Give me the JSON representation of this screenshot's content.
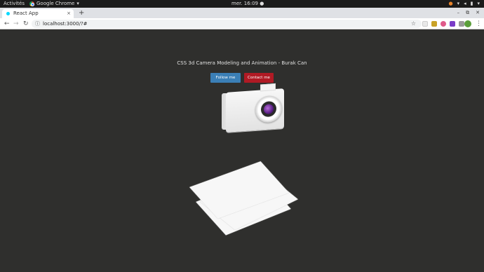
{
  "system": {
    "activities": "Activités",
    "app_name": "Google Chrome",
    "clock": "mer. 16:09"
  },
  "browser": {
    "tab_title": "React App",
    "url": "localhost:3000/?#",
    "new_tab_symbol": "+",
    "close_tab_symbol": "×"
  },
  "page": {
    "title": "CSS 3d Camera Modeling and Animation - Burak Can",
    "follow_button": "Follow me",
    "contact_button": "Contact me"
  },
  "colors": {
    "page_background": "#2f2f2d",
    "follow_button": "#3b7fb6",
    "contact_button": "#b01a24",
    "lens": "#7a3aa8"
  }
}
